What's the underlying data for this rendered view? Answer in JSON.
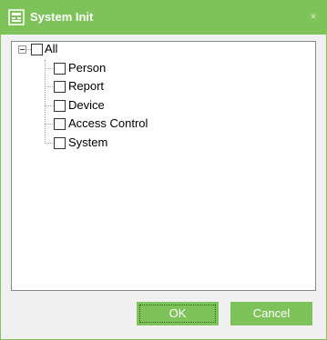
{
  "window": {
    "title": "System Init",
    "close_glyph": "×",
    "accent_color": "#7ec35a"
  },
  "tree": {
    "root": {
      "label": "All",
      "checked": false,
      "expanded": true
    },
    "children": [
      {
        "label": "Person",
        "checked": false
      },
      {
        "label": "Report",
        "checked": false
      },
      {
        "label": "Device",
        "checked": false
      },
      {
        "label": "Access Control",
        "checked": false
      },
      {
        "label": "System",
        "checked": false
      }
    ]
  },
  "buttons": {
    "ok_label": "OK",
    "cancel_label": "Cancel"
  },
  "icons": {
    "title": "system-init-icon",
    "close": "close-icon",
    "expander": "collapse-minus-icon"
  }
}
